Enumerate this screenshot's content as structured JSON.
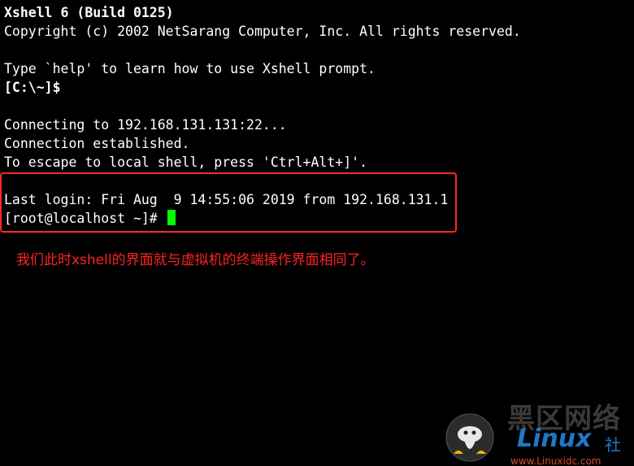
{
  "terminal": {
    "header_title": "Xshell 6 (Build 0125)",
    "copyright": "Copyright (c) 2002 NetSarang Computer, Inc. All rights reserved.",
    "help_hint": "Type `help' to learn how to use Xshell prompt.",
    "local_prompt": "[C:\\~]$",
    "connecting": "Connecting to 192.168.131.131:22...",
    "established": "Connection established.",
    "escape_hint": "To escape to local shell, press 'Ctrl+Alt+]'.",
    "last_login": "Last login: Fri Aug  9 14:55:06 2019 from 192.168.131.1",
    "remote_prompt": "[root@localhost ~]# "
  },
  "annotation": {
    "text": "我们此时xshell的界面就与虚拟机的终端操作界面相同了。",
    "color": "#ff2222"
  },
  "colors": {
    "background": "#000000",
    "foreground": "#ffffff",
    "cursor": "#00ff00",
    "highlight_box": "#ff2a2a"
  },
  "watermark": {
    "cn_text": "黑区网络",
    "linux_text": "Linux",
    "she_text": "社",
    "url_text": "www.Linuxidc.com",
    "logo_icon": "linux-penguin-icon"
  }
}
